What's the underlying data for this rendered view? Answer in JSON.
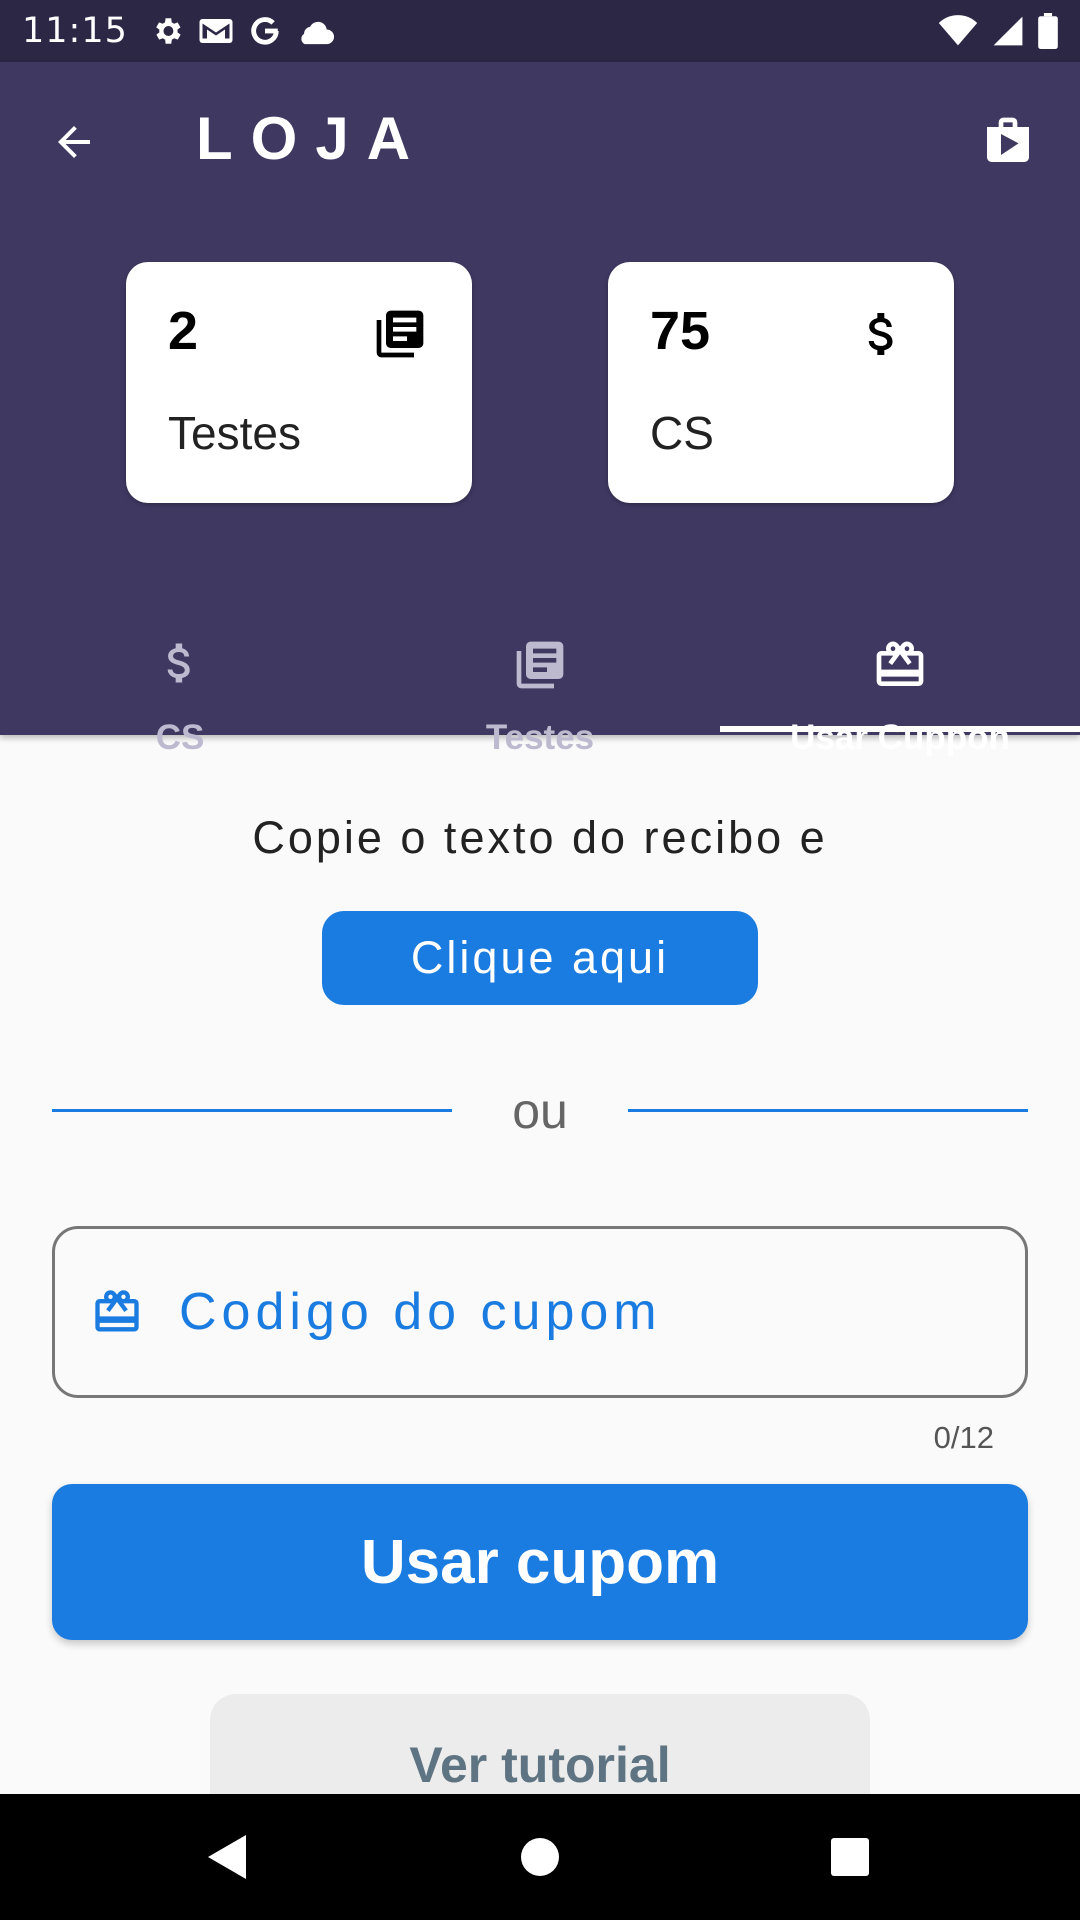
{
  "status_bar": {
    "time": "11:15",
    "left_icons": [
      "settings-icon",
      "gmail-icon",
      "google-icon",
      "cloud-icon"
    ],
    "right_icons": [
      "wifi-icon",
      "signal-icon",
      "battery-icon"
    ]
  },
  "header": {
    "title": "LOJA",
    "back_icon": "arrow-back-icon",
    "store_icon": "play-store-icon",
    "background": "#3f3962"
  },
  "stats": [
    {
      "value": "2",
      "label": "Testes",
      "icon": "library-books-icon"
    },
    {
      "value": "75",
      "label": "CS",
      "icon": "dollar-icon"
    }
  ],
  "tabs": [
    {
      "label": "CS",
      "icon": "dollar-icon",
      "active": false
    },
    {
      "label": "Testes",
      "icon": "library-books-icon",
      "active": false
    },
    {
      "label": "Usar Cuppon",
      "icon": "redeem-icon",
      "active": true
    }
  ],
  "content": {
    "instruction": "Copie o texto do recibo e",
    "click_button": "Clique aqui",
    "divider_text": "ou",
    "coupon_placeholder": "Codigo do cupom",
    "coupon_value": "",
    "char_counter": "0/12",
    "use_button": "Usar cupom",
    "tutorial_button": "Ver tutorial",
    "accent": "#1a7ce0"
  },
  "nav_bar": {
    "buttons": [
      "back-triangle-icon",
      "home-circle-icon",
      "recents-square-icon"
    ]
  }
}
